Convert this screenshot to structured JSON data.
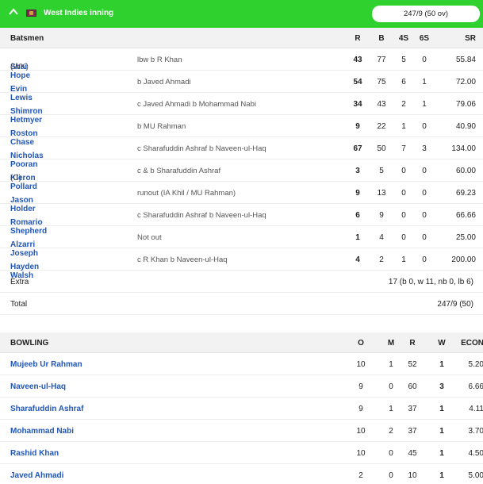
{
  "innings": {
    "title": "West Indies inning",
    "score": "247/9 (50 ov)",
    "colors": {
      "header_bg": "#2fd12f",
      "link": "#2256b5"
    }
  },
  "batting": {
    "headers": {
      "label": "Batsmen",
      "r": "R",
      "b": "B",
      "fours": "4S",
      "sixes": "6S",
      "sr": "SR"
    },
    "rows": [
      {
        "name": "Shai Hope",
        "tag": "(WK)",
        "dismissal": "lbw b R Khan",
        "r": "43",
        "b": "77",
        "fours": "5",
        "sixes": "0",
        "sr": "55.84"
      },
      {
        "name": "Evin Lewis",
        "tag": "",
        "dismissal": "b Javed Ahmadi",
        "r": "54",
        "b": "75",
        "fours": "6",
        "sixes": "1",
        "sr": "72.00"
      },
      {
        "name": "Shimron Hetmyer",
        "tag": "",
        "dismissal": "c Javed Ahmadi b Mohammad Nabi",
        "r": "34",
        "b": "43",
        "fours": "2",
        "sixes": "1",
        "sr": "79.06"
      },
      {
        "name": "Roston Chase",
        "tag": "",
        "dismissal": "b MU Rahman",
        "r": "9",
        "b": "22",
        "fours": "1",
        "sixes": "0",
        "sr": "40.90"
      },
      {
        "name": "Nicholas Pooran",
        "tag": "",
        "dismissal": "c Sharafuddin Ashraf b Naveen-ul-Haq",
        "r": "67",
        "b": "50",
        "fours": "7",
        "sixes": "3",
        "sr": "134.00"
      },
      {
        "name": "Kieron Pollard",
        "tag": "(C)",
        "dismissal": "c & b Sharafuddin Ashraf",
        "r": "3",
        "b": "5",
        "fours": "0",
        "sixes": "0",
        "sr": "60.00"
      },
      {
        "name": "Jason Holder",
        "tag": "",
        "dismissal": "runout (IA Khil / MU Rahman)",
        "r": "9",
        "b": "13",
        "fours": "0",
        "sixes": "0",
        "sr": "69.23"
      },
      {
        "name": "Romario Shepherd",
        "tag": "",
        "dismissal": "c Sharafuddin Ashraf b Naveen-ul-Haq",
        "r": "6",
        "b": "9",
        "fours": "0",
        "sixes": "0",
        "sr": "66.66"
      },
      {
        "name": "Alzarri Joseph",
        "tag": "",
        "dismissal": "Not out",
        "r": "1",
        "b": "4",
        "fours": "0",
        "sixes": "0",
        "sr": "25.00"
      },
      {
        "name": "Hayden Walsh",
        "tag": "",
        "dismissal": "c R Khan b Naveen-ul-Haq",
        "r": "4",
        "b": "2",
        "fours": "1",
        "sixes": "0",
        "sr": "200.00"
      }
    ],
    "extra": {
      "label": "Extra",
      "value": "17 (b 0, w 11, nb 0, lb 6)"
    },
    "total": {
      "label": "Total",
      "value": "247/9 (50)"
    }
  },
  "bowling": {
    "headers": {
      "label": "BOWLING",
      "o": "O",
      "m": "M",
      "r": "R",
      "w": "W",
      "econ": "ECON"
    },
    "rows": [
      {
        "name": "Mujeeb Ur Rahman",
        "o": "10",
        "m": "1",
        "r": "52",
        "w": "1",
        "econ": "5.20"
      },
      {
        "name": "Naveen-ul-Haq",
        "o": "9",
        "m": "0",
        "r": "60",
        "w": "3",
        "econ": "6.66"
      },
      {
        "name": "Sharafuddin Ashraf",
        "o": "9",
        "m": "1",
        "r": "37",
        "w": "1",
        "econ": "4.11"
      },
      {
        "name": "Mohammad Nabi",
        "o": "10",
        "m": "2",
        "r": "37",
        "w": "1",
        "econ": "3.70"
      },
      {
        "name": "Rashid Khan",
        "o": "10",
        "m": "0",
        "r": "45",
        "w": "1",
        "econ": "4.50"
      },
      {
        "name": "Javed Ahmadi",
        "o": "2",
        "m": "0",
        "r": "10",
        "w": "1",
        "econ": "5.00"
      }
    ]
  }
}
